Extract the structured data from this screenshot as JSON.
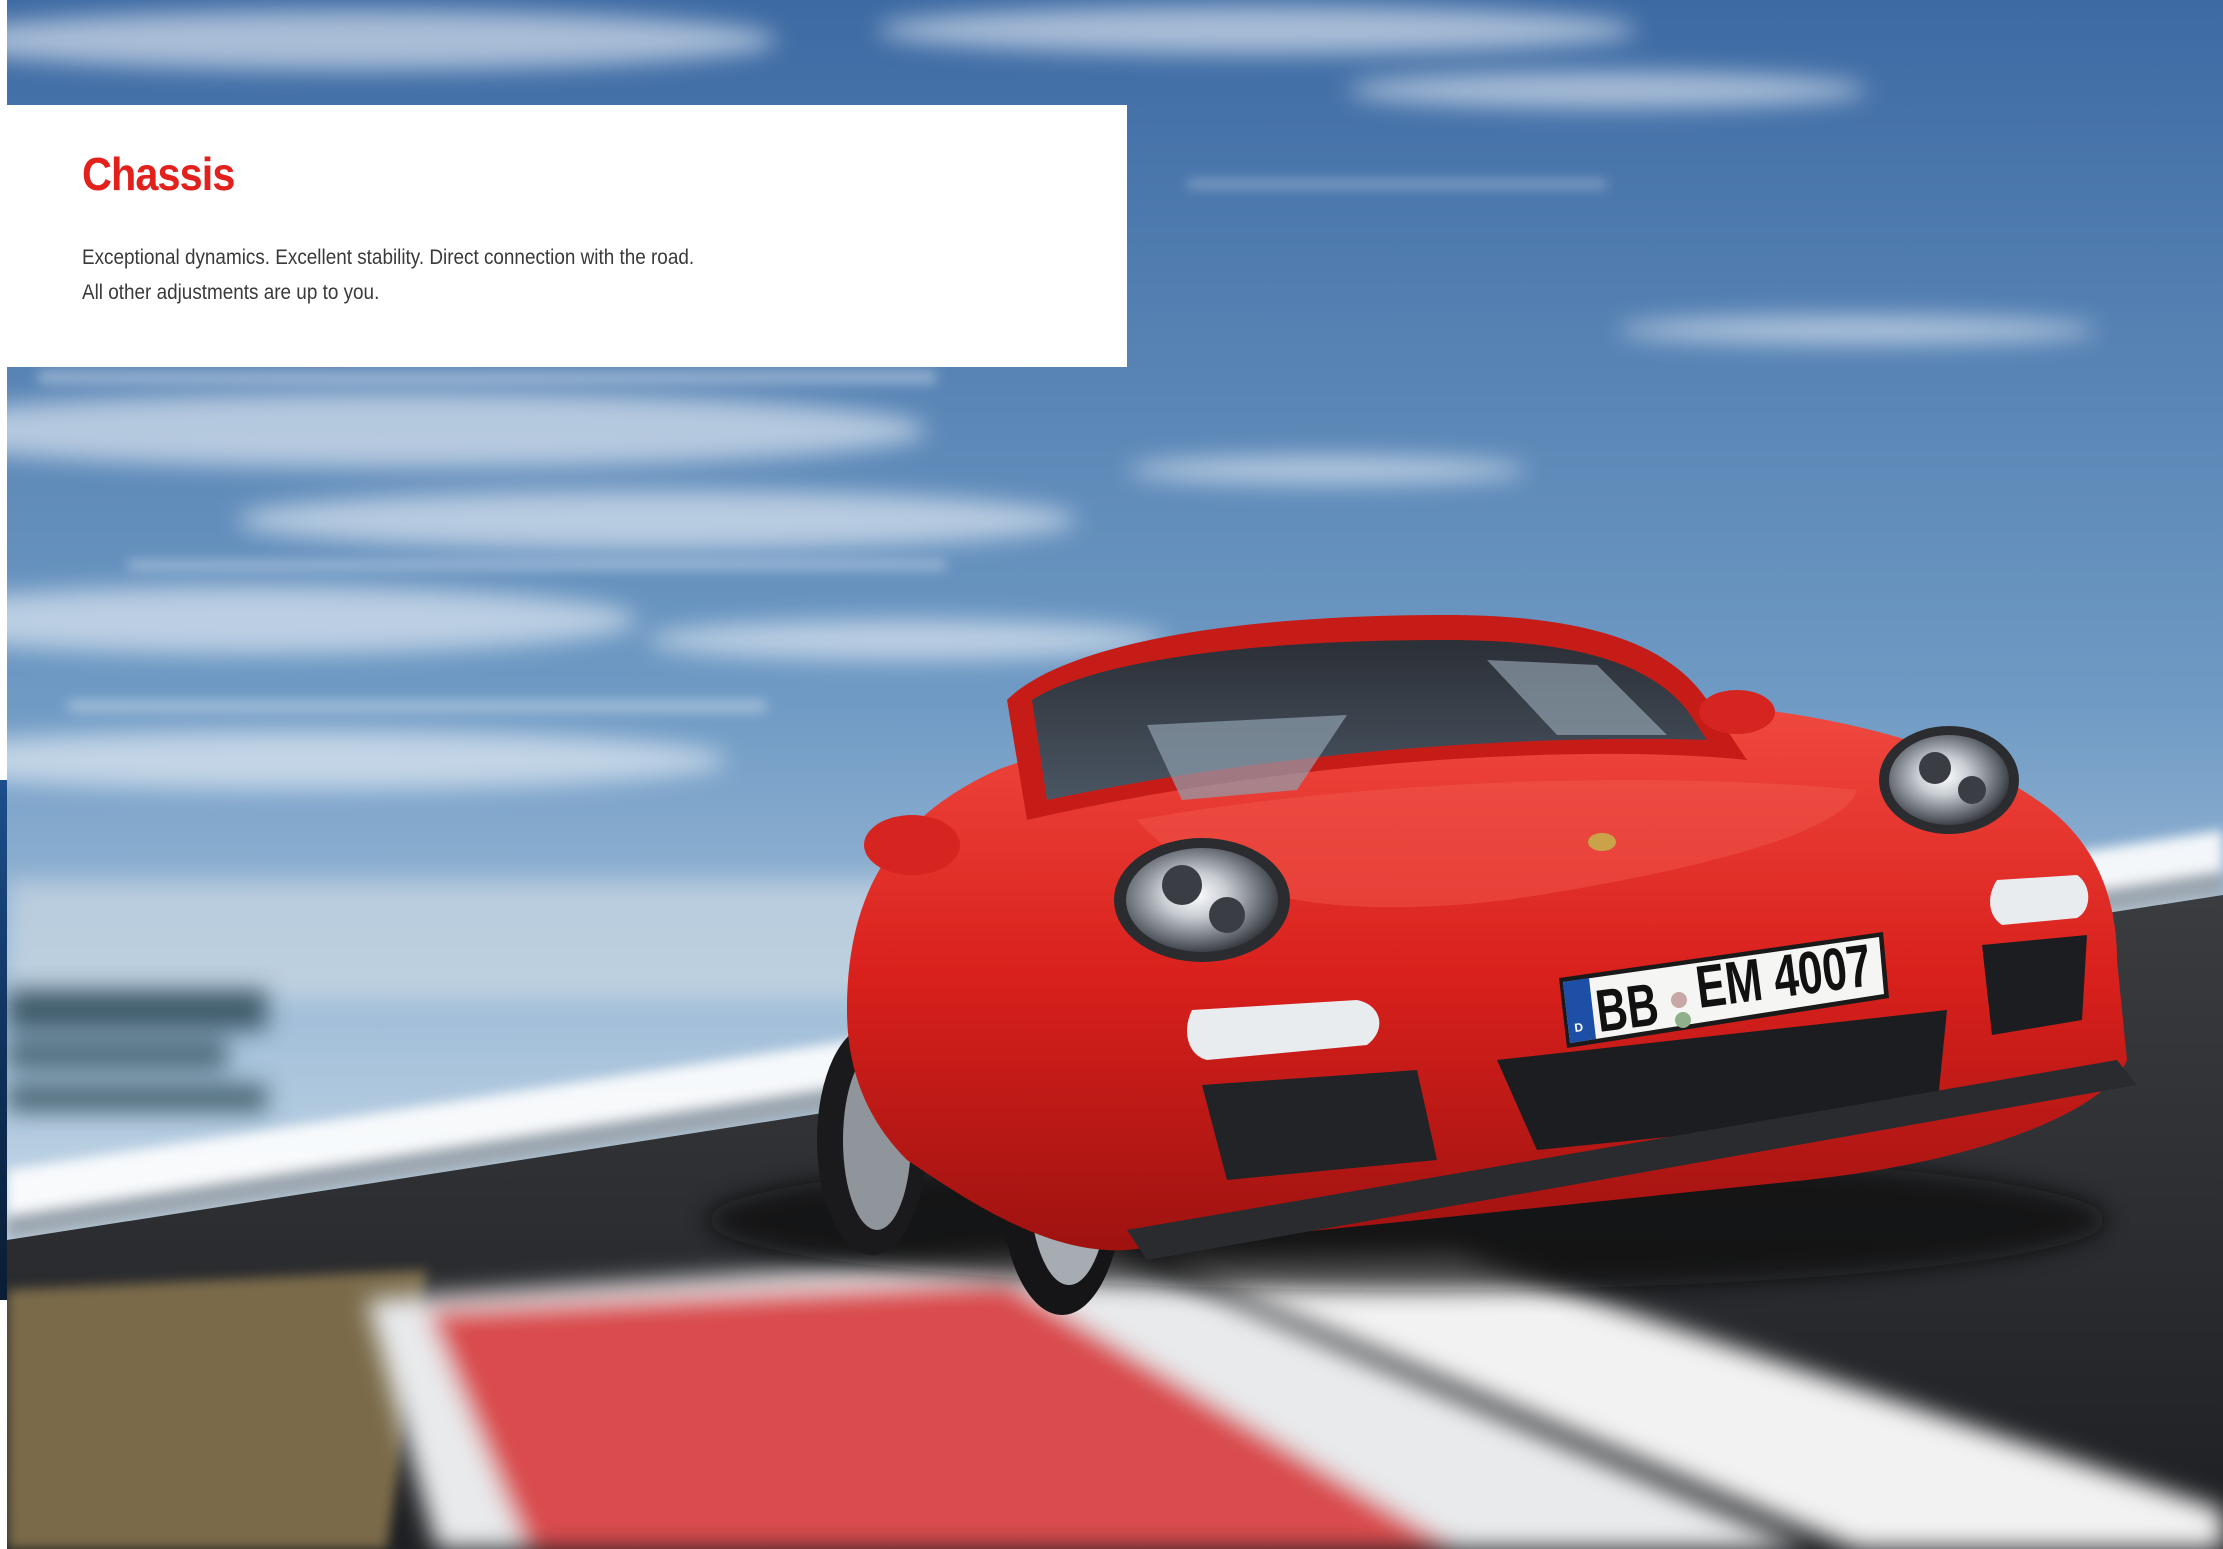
{
  "title": "Chassis",
  "lead": [
    "Exceptional dynamics. Excellent stability. Direct connection with the road.",
    "All other adjustments are up to you."
  ],
  "plate": {
    "country": "D",
    "left": "BB",
    "right": "EM 4007"
  },
  "colors": {
    "accent": "#e2211c",
    "body_text": "#3a3a3a",
    "panel": "#ffffff",
    "car_red": "#d9201c",
    "sky_top": "#3f6ea8",
    "sky_bottom": "#c4d6e4"
  }
}
